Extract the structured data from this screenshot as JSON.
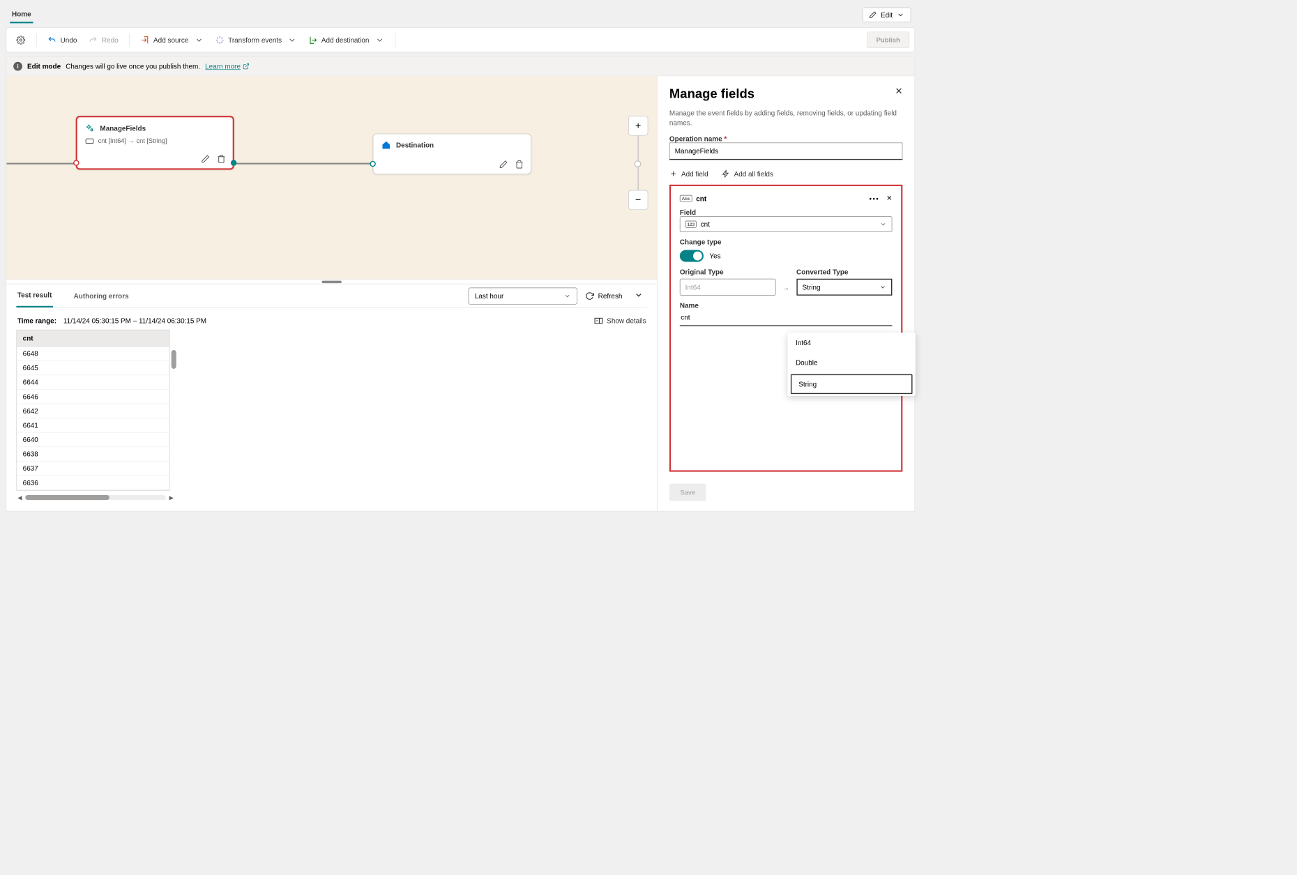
{
  "tabs": {
    "home": "Home"
  },
  "edit_button": "Edit",
  "toolbar": {
    "undo": "Undo",
    "redo": "Redo",
    "add_source": "Add source",
    "transform": "Transform events",
    "add_dest": "Add destination",
    "publish": "Publish"
  },
  "info": {
    "mode": "Edit mode",
    "msg": "Changes will go live once you publish them.",
    "learn": "Learn more"
  },
  "nodes": {
    "manage": {
      "title": "ManageFields",
      "mapping": "cnt [Int64] → cnt [String]"
    },
    "dest": {
      "title": "Destination"
    }
  },
  "bottom": {
    "tab_result": "Test result",
    "tab_errors": "Authoring errors",
    "range_sel": "Last hour",
    "refresh": "Refresh",
    "time_label": "Time range:",
    "time_value": "11/14/24 05:30:15 PM – 11/14/24 06:30:15 PM",
    "show_details": "Show details",
    "col": "cnt",
    "rows": [
      "6648",
      "6645",
      "6644",
      "6646",
      "6642",
      "6641",
      "6640",
      "6638",
      "6637",
      "6636"
    ]
  },
  "side": {
    "title": "Manage fields",
    "desc": "Manage the event fields by adding fields, removing fields, or updating field names.",
    "op_label": "Operation name",
    "op_value": "ManageFields",
    "add_field": "Add field",
    "add_all": "Add all fields",
    "field": {
      "title": "cnt",
      "field_label": "Field",
      "field_value": "cnt",
      "change_label": "Change type",
      "yes": "Yes",
      "orig_label": "Original Type",
      "orig_value": "Int64",
      "conv_label": "Converted Type",
      "conv_value": "String",
      "name_label": "Name",
      "name_value": "cnt"
    },
    "dropdown": [
      "Int64",
      "Double",
      "String"
    ],
    "save": "Save"
  }
}
